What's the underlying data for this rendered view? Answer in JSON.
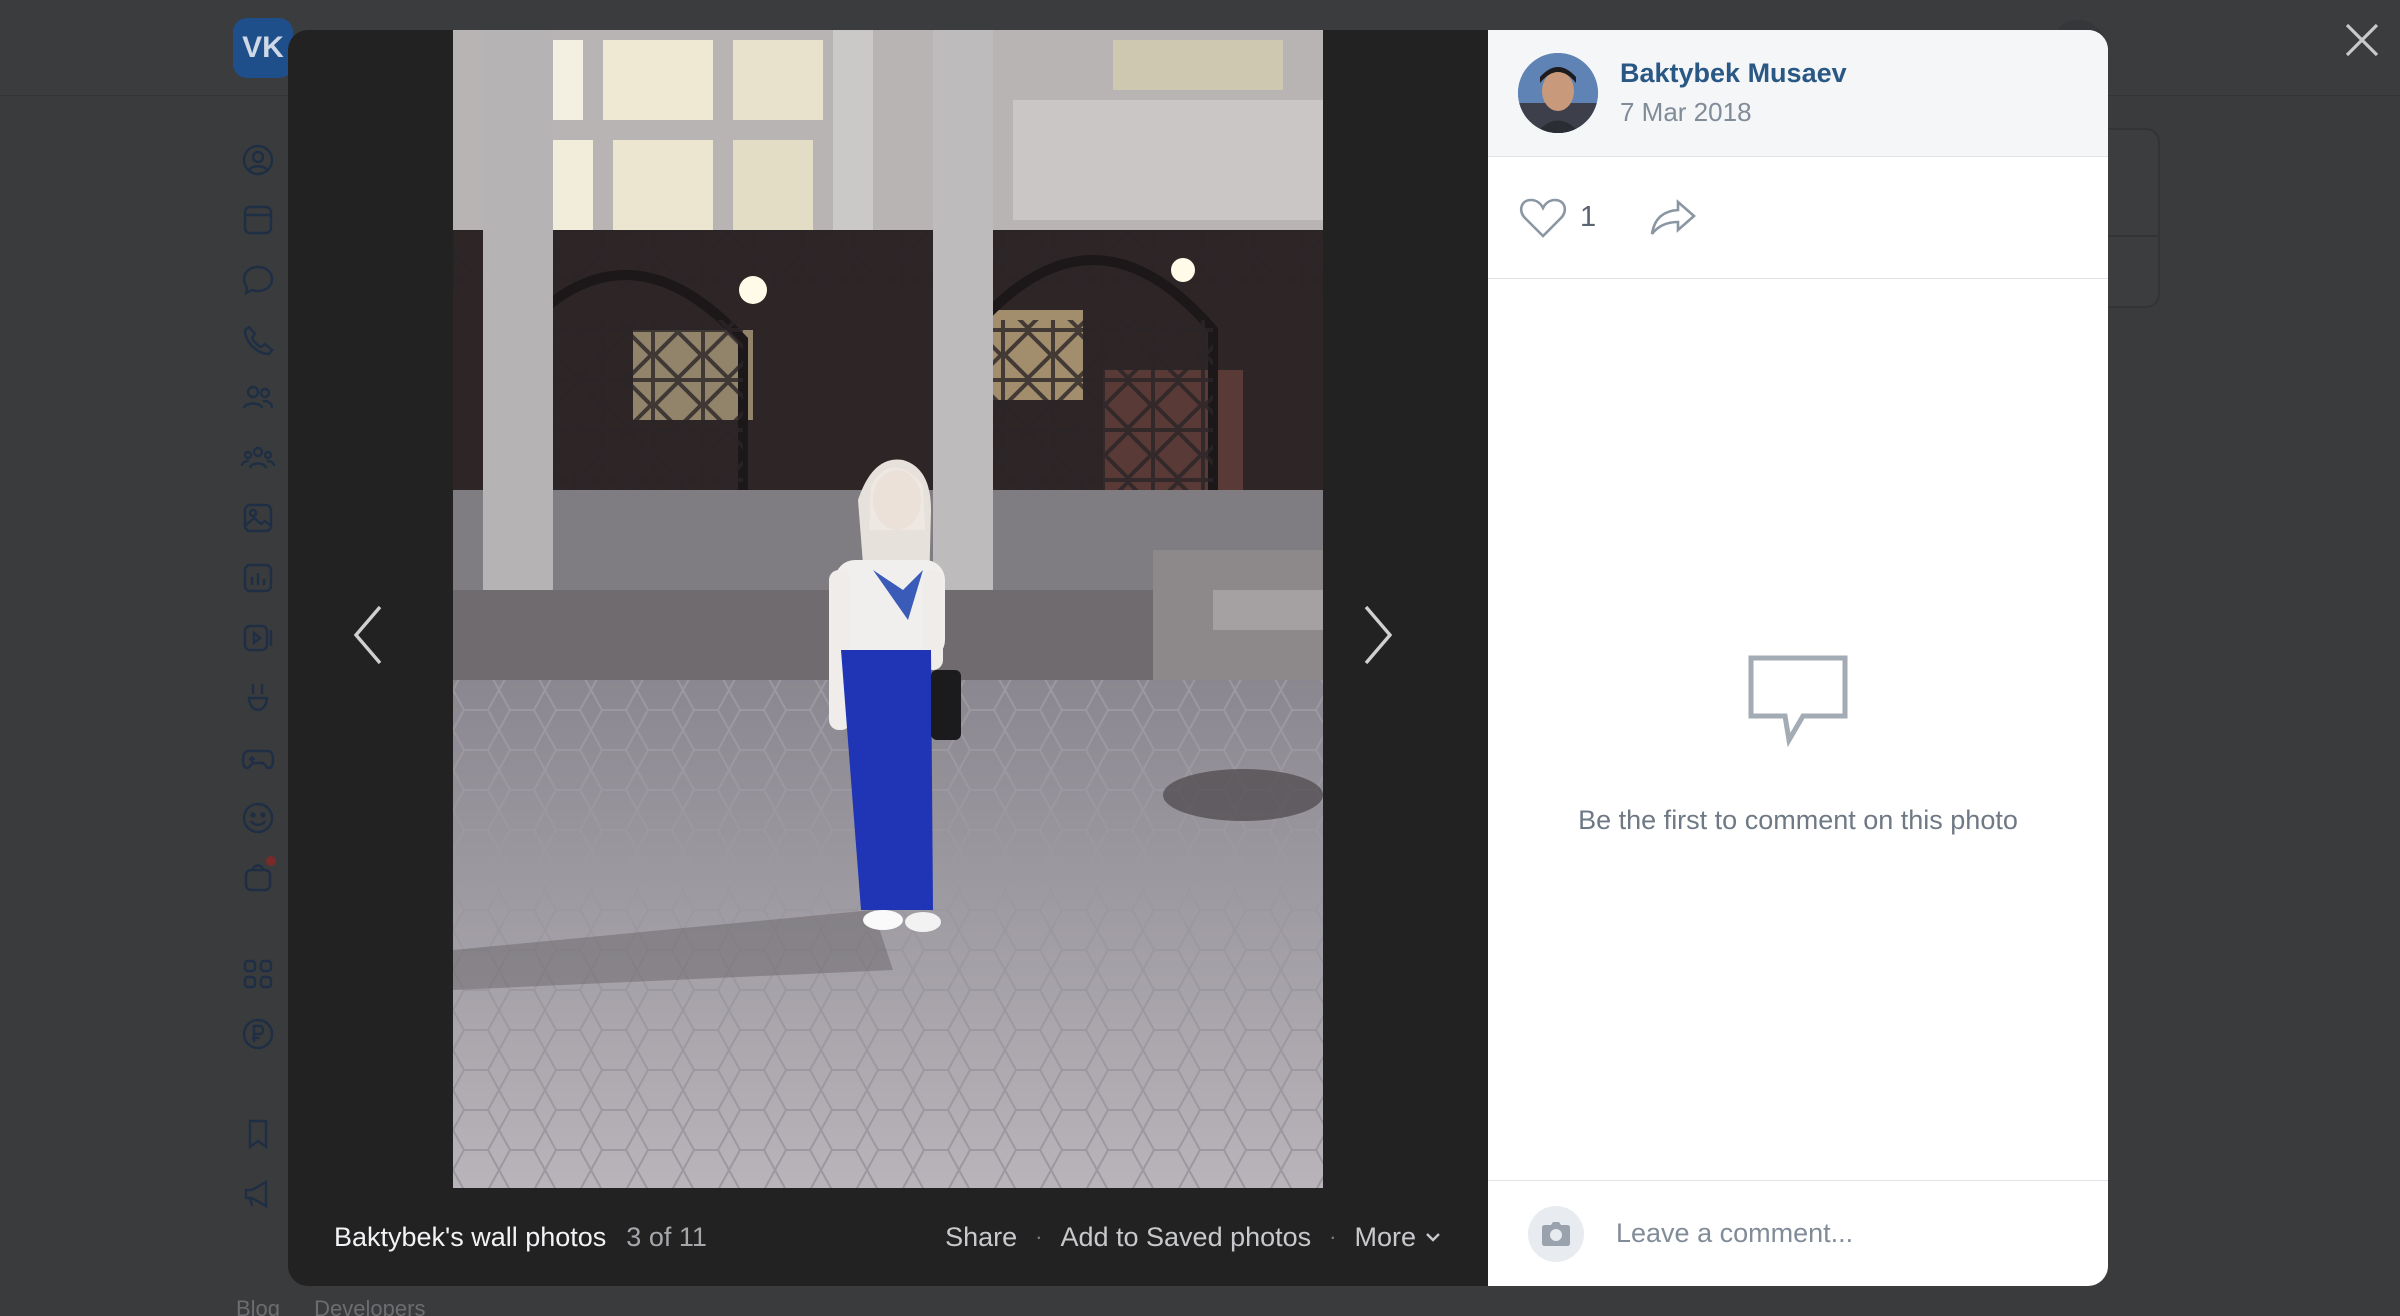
{
  "background": {
    "logo_text": "VK",
    "footer_links": [
      "Blog",
      "Developers"
    ]
  },
  "viewer": {
    "album_title": "Baktybek's wall photos",
    "counter": "3 of 11",
    "actions": {
      "share": "Share",
      "save": "Add to Saved photos",
      "more": "More"
    }
  },
  "author": {
    "name": "Baktybek Musaev",
    "date": "7 Mar 2018"
  },
  "reactions": {
    "likes": "1"
  },
  "comments": {
    "empty_text": "Be the first to comment on this photo",
    "placeholder": "Leave a comment..."
  },
  "colors": {
    "link": "#2a5885",
    "muted": "#818c99",
    "viewer_bg": "#222222"
  }
}
